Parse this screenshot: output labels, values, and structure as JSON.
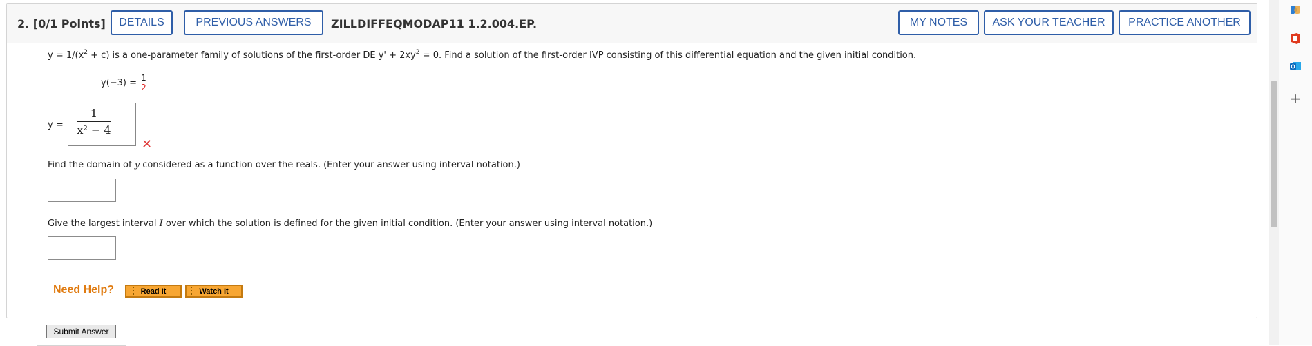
{
  "header": {
    "question_label": "2.  [0/1 Points]",
    "details_label": "DETAILS",
    "previous_answers_label": "PREVIOUS ANSWERS",
    "assignment_code": "ZILLDIFFEQMODAP11 1.2.004.EP.",
    "my_notes_label": "MY NOTES",
    "ask_teacher_label": "ASK YOUR TEACHER",
    "practice_another_label": "PRACTICE ANOTHER"
  },
  "problem": {
    "part1": "y = 1/(x",
    "part2": " + c) is a one-parameter family of solutions of the first-order DE y' + 2xy",
    "part3": " = 0. Find a solution of the first-order IVP consisting of this differential equation and the given initial condition.",
    "exp": "2",
    "initial_condition_lhs": "y(−3) =",
    "ic_num": "1",
    "ic_den": "2"
  },
  "answer": {
    "y_label": "y =",
    "numerator": "1",
    "denominator": "x² − 4",
    "status": "incorrect"
  },
  "domain_question": {
    "text_a": "Find the domain of ",
    "var": "y",
    "text_b": " considered as a function over the reals. (Enter your answer using interval notation.)",
    "value": ""
  },
  "interval_question": {
    "text_a": "Give the largest interval ",
    "var": "I",
    "text_b": " over which the solution is defined for the given initial condition. (Enter your answer using interval notation.)",
    "value": ""
  },
  "help": {
    "need_help_label": "Need Help?",
    "read_it_label": "Read It",
    "watch_it_label": "Watch It"
  },
  "submit_label": "Submit Answer",
  "side_rail": {
    "icons": [
      "copilot-icon",
      "office-icon",
      "outlook-icon",
      "add-icon"
    ],
    "add_glyph": "+"
  },
  "colors": {
    "accent": "#2f5ea8",
    "help_orange": "#e07b10",
    "error_red": "#e03a3a"
  }
}
